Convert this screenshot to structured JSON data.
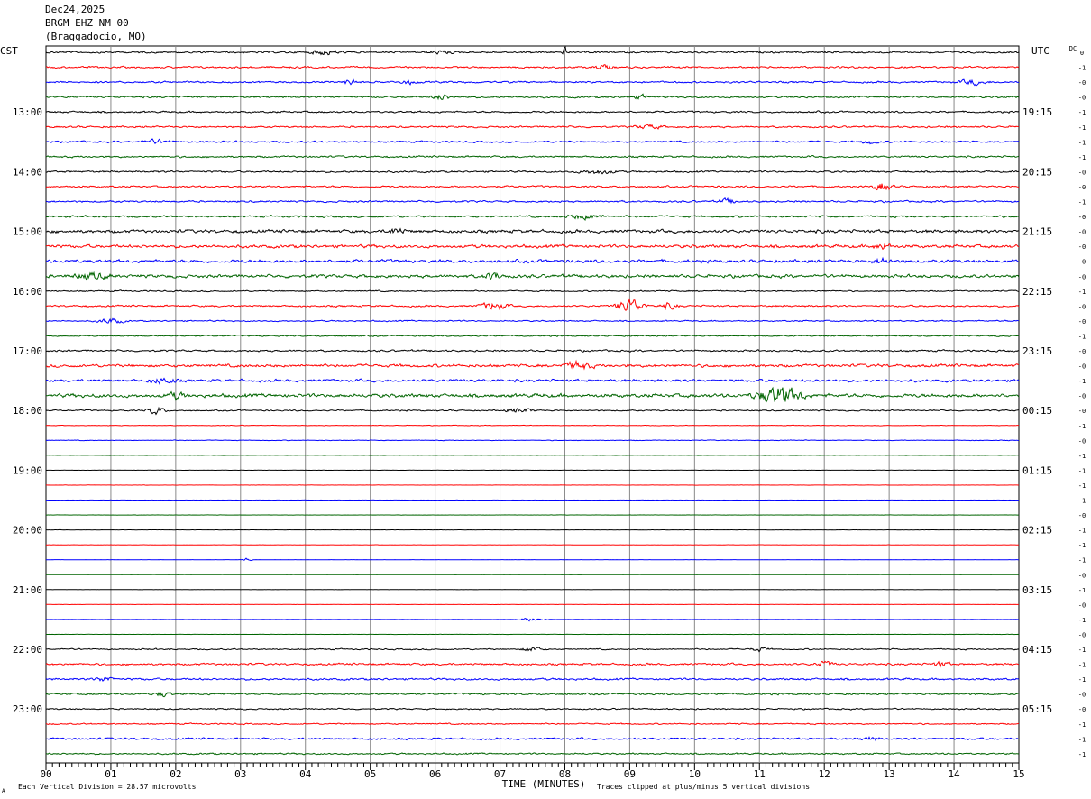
{
  "header": {
    "date": "Dec24,2025",
    "station": "BRGM EHZ NM 00",
    "location": "(Braggadocio, MO)"
  },
  "chart_data": {
    "type": "line",
    "title": "",
    "xlabel": "TIME (MINUTES)",
    "xlim": [
      0,
      15
    ],
    "x_ticks": [
      "00",
      "01",
      "02",
      "03",
      "04",
      "05",
      "06",
      "07",
      "08",
      "09",
      "10",
      "11",
      "12",
      "13",
      "14",
      "15"
    ],
    "left_axis_label": "CST",
    "right_axis_label": "UTC",
    "dc_label": "DC",
    "left_hour_labels": [
      "13:00",
      "14:00",
      "15:00",
      "16:00",
      "17:00",
      "18:00",
      "19:00",
      "20:00",
      "21:00",
      "22:00",
      "23:00"
    ],
    "right_hour_labels": [
      "19:15",
      "20:15",
      "21:15",
      "22:15",
      "23:15",
      "00:15",
      "01:15",
      "02:15",
      "03:15",
      "04:15",
      "05:15"
    ],
    "trace_colors": [
      "#000000",
      "#ff0000",
      "#0000ff",
      "#006400"
    ],
    "trace_count": 48,
    "dc_offsets": [
      "0",
      "-1",
      "-0",
      "-0",
      "-1",
      "-1",
      "-1",
      "-1",
      "-0",
      "-0",
      "-1",
      "-0",
      "-0",
      "-0",
      "-0",
      "-0",
      "-1",
      "-0",
      "-0",
      "-1",
      "-0",
      "-0",
      "-1",
      "-0",
      "-0",
      "-1",
      "-0",
      "-1",
      "-1",
      "-1",
      "-1",
      "-0",
      "-1",
      "-1",
      "-1",
      "-0",
      "-1",
      "-0",
      "-1",
      "-0",
      "-1",
      "-1",
      "-1",
      "-0",
      "-0",
      "-1",
      "-1",
      "-1"
    ],
    "noise_level": [
      0.8,
      0.8,
      0.8,
      0.8,
      0.8,
      0.8,
      0.8,
      0.8,
      0.8,
      0.8,
      0.8,
      0.9,
      1.4,
      1.4,
      1.4,
      1.4,
      0.6,
      0.8,
      0.6,
      0.6,
      0.8,
      1.3,
      1.2,
      1.6,
      0.6,
      0.25,
      0.3,
      0.15,
      0.1,
      0.1,
      0.1,
      0.1,
      0.1,
      0.1,
      0.1,
      0.1,
      0.1,
      0.1,
      0.1,
      0.1,
      0.6,
      0.9,
      0.9,
      0.8,
      0.6,
      0.6,
      0.9,
      0.7
    ],
    "events": [
      {
        "row": 0,
        "minute": 4.3,
        "amplitude": 2.5,
        "duration": 0.3
      },
      {
        "row": 0,
        "minute": 6.1,
        "amplitude": 2,
        "duration": 0.2
      },
      {
        "row": 0,
        "minute": 8.0,
        "amplitude": 6,
        "duration": 0.05
      },
      {
        "row": 1,
        "minute": 8.6,
        "amplitude": 2.5,
        "duration": 0.2
      },
      {
        "row": 2,
        "minute": 4.7,
        "amplitude": 2.5,
        "duration": 0.2
      },
      {
        "row": 2,
        "minute": 5.6,
        "amplitude": 2,
        "duration": 0.2
      },
      {
        "row": 2,
        "minute": 14.3,
        "amplitude": 2.5,
        "duration": 0.3
      },
      {
        "row": 3,
        "minute": 6.1,
        "amplitude": 3,
        "duration": 0.2
      },
      {
        "row": 3,
        "minute": 9.2,
        "amplitude": 2,
        "duration": 0.2
      },
      {
        "row": 5,
        "minute": 9.3,
        "amplitude": 2,
        "duration": 0.3
      },
      {
        "row": 6,
        "minute": 1.7,
        "amplitude": 2,
        "duration": 0.3
      },
      {
        "row": 6,
        "minute": 12.7,
        "amplitude": 2,
        "duration": 0.2
      },
      {
        "row": 8,
        "minute": 8.5,
        "amplitude": 2,
        "duration": 0.4
      },
      {
        "row": 9,
        "minute": 12.9,
        "amplitude": 5,
        "duration": 0.2
      },
      {
        "row": 10,
        "minute": 10.5,
        "amplitude": 2.5,
        "duration": 0.2
      },
      {
        "row": 11,
        "minute": 8.3,
        "amplitude": 2.5,
        "duration": 0.4
      },
      {
        "row": 12,
        "minute": 5.4,
        "amplitude": 3,
        "duration": 0.2
      },
      {
        "row": 13,
        "minute": 12.9,
        "amplitude": 3,
        "duration": 0.2
      },
      {
        "row": 14,
        "minute": 12.9,
        "amplitude": 3,
        "duration": 0.2
      },
      {
        "row": 15,
        "minute": 6.9,
        "amplitude": 4,
        "duration": 0.2
      },
      {
        "row": 15,
        "minute": 0.7,
        "amplitude": 3,
        "duration": 0.4
      },
      {
        "row": 17,
        "minute": 6.9,
        "amplitude": 4,
        "duration": 0.3
      },
      {
        "row": 17,
        "minute": 9.0,
        "amplitude": 7,
        "duration": 0.3
      },
      {
        "row": 17,
        "minute": 9.6,
        "amplitude": 3,
        "duration": 0.2
      },
      {
        "row": 18,
        "minute": 1.0,
        "amplitude": 2.5,
        "duration": 0.3
      },
      {
        "row": 21,
        "minute": 8.2,
        "amplitude": 4,
        "duration": 0.3
      },
      {
        "row": 22,
        "minute": 1.8,
        "amplitude": 3,
        "duration": 0.3
      },
      {
        "row": 23,
        "minute": 11.3,
        "amplitude": 9,
        "duration": 0.5
      },
      {
        "row": 23,
        "minute": 2.0,
        "amplitude": 3,
        "duration": 0.2
      },
      {
        "row": 24,
        "minute": 1.7,
        "amplitude": 4,
        "duration": 0.2
      },
      {
        "row": 24,
        "minute": 7.3,
        "amplitude": 2.5,
        "duration": 0.3
      },
      {
        "row": 34,
        "minute": 3.1,
        "amplitude": 2,
        "duration": 0.1
      },
      {
        "row": 38,
        "minute": 7.5,
        "amplitude": 2,
        "duration": 0.3
      },
      {
        "row": 40,
        "minute": 7.5,
        "amplitude": 2.5,
        "duration": 0.2
      },
      {
        "row": 40,
        "minute": 11.0,
        "amplitude": 2,
        "duration": 0.2
      },
      {
        "row": 41,
        "minute": 12.0,
        "amplitude": 2.5,
        "duration": 0.2
      },
      {
        "row": 41,
        "minute": 13.8,
        "amplitude": 2.5,
        "duration": 0.2
      },
      {
        "row": 42,
        "minute": 0.9,
        "amplitude": 2.5,
        "duration": 0.2
      },
      {
        "row": 43,
        "minute": 1.8,
        "amplitude": 2.5,
        "duration": 0.2
      },
      {
        "row": 46,
        "minute": 12.7,
        "amplitude": 2,
        "duration": 0.2
      }
    ]
  },
  "footer": {
    "scale_note": "Each Vertical Division =   28.57 microvolts",
    "clip_note": "Traces clipped at plus/minus 5 vertical divisions",
    "corner_mark": "A"
  }
}
